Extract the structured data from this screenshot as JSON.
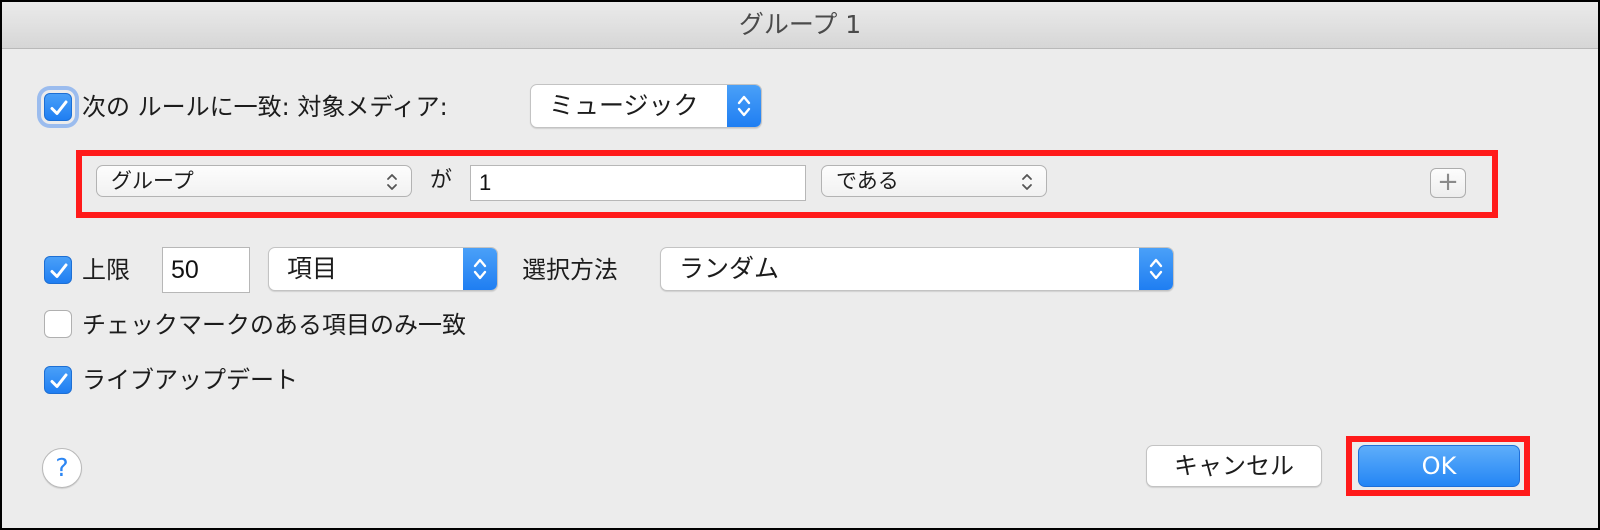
{
  "window": {
    "title": "グループ 1"
  },
  "rule_header": {
    "checked": true,
    "label": "次の ルールに一致: 対象メディア:",
    "media_value": "ミュージック"
  },
  "rule": {
    "field_value": "グループ",
    "connector": "が",
    "input_value": "1",
    "operator_value": "である",
    "add_label": "+"
  },
  "limit": {
    "checked": true,
    "label": "上限",
    "value": "50",
    "unit_value": "項目",
    "selection_label": "選択方法",
    "selection_value": "ランダム"
  },
  "checked_only": {
    "checked": false,
    "label": "チェックマークのある項目のみ一致"
  },
  "live_update": {
    "checked": true,
    "label": "ライブアップデート"
  },
  "footer": {
    "help_label": "?",
    "cancel_label": "キャンセル",
    "ok_label": "OK"
  },
  "colors": {
    "accent": "#2486f5",
    "highlight": "#ff1a1a",
    "window_bg": "#ececec"
  }
}
